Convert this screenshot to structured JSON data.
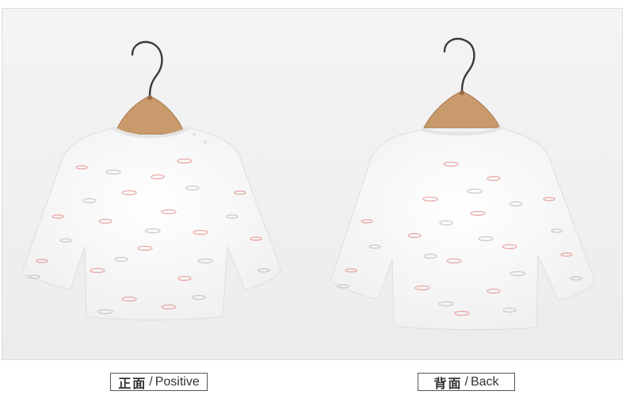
{
  "captions": {
    "front": {
      "zh": "正面",
      "sep": "/",
      "en": "Positive"
    },
    "back": {
      "zh": "背面",
      "sep": "/",
      "en": "Back"
    }
  },
  "colors": {
    "background": "#f1f1f1",
    "shirt": "#fbfbfb",
    "hanger_wood": "#c89a6c",
    "hanger_hook": "#3a3a3a",
    "fish_pink": "#e8a4a4",
    "fish_gray": "#c8c8c8"
  },
  "image": {
    "subject": "shirt-on-hanger"
  }
}
